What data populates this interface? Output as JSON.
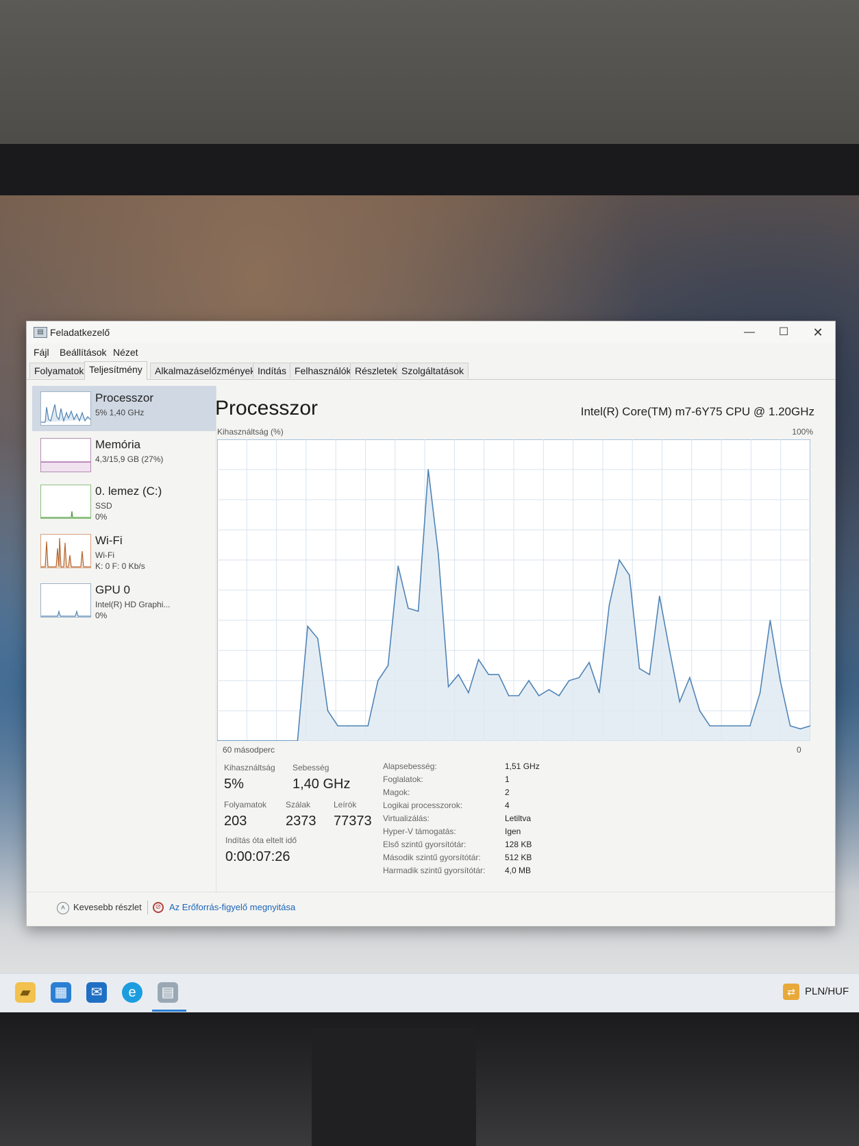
{
  "window": {
    "title": "Feladatkezelő",
    "controls": {
      "minimize": "—",
      "maximize": "☐",
      "close": "✕"
    }
  },
  "menu": {
    "file": "Fájl",
    "settings": "Beállítások",
    "view": "Nézet"
  },
  "tabs": [
    {
      "label": "Folyamatok",
      "active": false
    },
    {
      "label": "Teljesítmény",
      "active": true
    },
    {
      "label": "Alkalmazáselőzmények",
      "active": false
    },
    {
      "label": "Indítás",
      "active": false
    },
    {
      "label": "Felhasználók",
      "active": false
    },
    {
      "label": "Részletek",
      "active": false
    },
    {
      "label": "Szolgáltatások",
      "active": false
    }
  ],
  "sidebar": {
    "items": [
      {
        "title": "Processzor",
        "lines": [
          "5% 1,40 GHz"
        ],
        "color": "#4f84b6",
        "active": true
      },
      {
        "title": "Memória",
        "lines": [
          "4,3/15,9 GB (27%)"
        ],
        "color": "#9b4f96",
        "active": false
      },
      {
        "title": "0. lemez (C:)",
        "lines": [
          "SSD",
          "0%"
        ],
        "color": "#4d9a3a",
        "active": false
      },
      {
        "title": "Wi-Fi",
        "lines": [
          "Wi-Fi",
          "K: 0 F: 0 Kb/s"
        ],
        "color": "#b5652d",
        "active": false
      },
      {
        "title": "GPU 0",
        "lines": [
          "Intel(R) HD Graphi...",
          "0%"
        ],
        "color": "#4f84b6",
        "active": false
      }
    ]
  },
  "main": {
    "title": "Processzor",
    "cpu_name": "Intel(R) Core(TM) m7-6Y75 CPU @ 1.20GHz",
    "y_axis_label": "Kihasználtság (%)",
    "y_max_label": "100%",
    "x_left_label": "60 másodperc",
    "x_right_label": "0",
    "line_color": "#4f84b6",
    "fill_color": "#dfe8f1"
  },
  "chart_data": {
    "type": "area",
    "ylabel": "Kihasználtság (%)",
    "ylim": [
      0,
      100
    ],
    "values": [
      0,
      0,
      0,
      0,
      0,
      0,
      0,
      0,
      0,
      38,
      34,
      10,
      5,
      5,
      5,
      5,
      20,
      25,
      58,
      44,
      43,
      90,
      62,
      18,
      22,
      16,
      27,
      22,
      22,
      15,
      15,
      20,
      15,
      17,
      15,
      20,
      21,
      26,
      16,
      45,
      60,
      55,
      24,
      22,
      48,
      30,
      13,
      21,
      10,
      5,
      5,
      5,
      5,
      5,
      16,
      40,
      20,
      5,
      4,
      5
    ]
  },
  "stats": {
    "utilization": {
      "label": "Kihasználtság",
      "value": "5%"
    },
    "speed": {
      "label": "Sebesség",
      "value": "1,40 GHz"
    },
    "processes": {
      "label": "Folyamatok",
      "value": "203"
    },
    "threads": {
      "label": "Szálak",
      "value": "2373"
    },
    "handles": {
      "label": "Leírók",
      "value": "77373"
    },
    "uptime": {
      "label": "Indítás óta eltelt idő",
      "value": "0:00:07:26"
    }
  },
  "specs": [
    {
      "label": "Alapsebesség:",
      "value": "1,51 GHz"
    },
    {
      "label": "Foglalatok:",
      "value": "1"
    },
    {
      "label": "Magok:",
      "value": "2"
    },
    {
      "label": "Logikai processzorok:",
      "value": "4"
    },
    {
      "label": "Virtualizálás:",
      "value": "Letiltva"
    },
    {
      "label": "Hyper-V támogatás:",
      "value": "Igen"
    },
    {
      "label": "Első szintű gyorsítótár:",
      "value": "128 KB"
    },
    {
      "label": "Második szintű gyorsítótár:",
      "value": "512 KB"
    },
    {
      "label": "Harmadik szintű gyorsítótár:",
      "value": "4,0 MB"
    }
  ],
  "footer": {
    "less_details": "Kevesebb részlet",
    "resource_monitor": "Az Erőforrás-figyelő megnyitása"
  },
  "taskbar": {
    "icons": [
      "file-explorer-icon",
      "store-icon",
      "outlook-icon",
      "edge-icon",
      "task-manager-icon"
    ],
    "currency": "PLN/HUF"
  }
}
